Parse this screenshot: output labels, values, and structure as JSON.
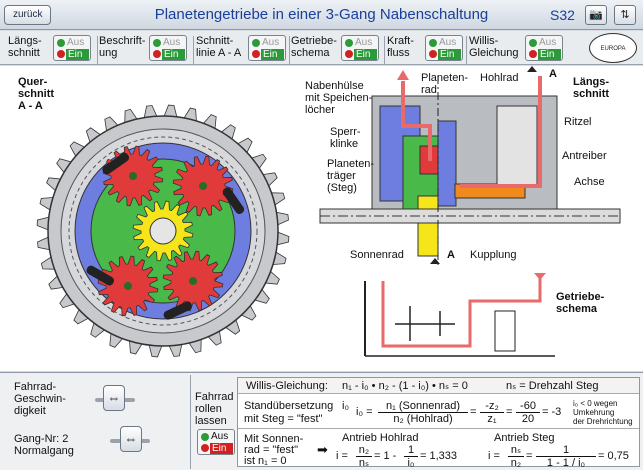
{
  "header": {
    "back_label": "zurück",
    "title": "Planetengetriebe in einer 3-Gang Nabenschaltung",
    "page_number": "S32",
    "icons": [
      "camera-icon",
      "sort-icon"
    ]
  },
  "toggles": [
    {
      "label_line1": "Längs-",
      "label_line2": "schnitt",
      "off": "Aus",
      "on": "Ein",
      "state": "Ein"
    },
    {
      "label_line1": "Beschrift-",
      "label_line2": "ung",
      "off": "Aus",
      "on": "Ein",
      "state": "Ein"
    },
    {
      "label_line1": "Schnitt-",
      "label_line2": "linie A - A",
      "off": "Aus",
      "on": "Ein",
      "state": "Ein"
    },
    {
      "label_line1": "Getriebe-",
      "label_line2": "schema",
      "off": "Aus",
      "on": "Ein",
      "state": "Ein"
    },
    {
      "label_line1": "Kraft-",
      "label_line2": "fluss",
      "off": "Aus",
      "on": "Ein",
      "state": "Ein"
    },
    {
      "label_line1": "Willis-",
      "label_line2": "Gleichung",
      "off": "Aus",
      "on": "Ein",
      "state": "Ein"
    }
  ],
  "logo_text": "EUROPA LEHRMITTEL",
  "diagram": {
    "cross_section_title": "Quer-\nschnitt\nA - A",
    "longitudinal_title": "Längs-\nschnitt",
    "section_mark": "A",
    "labels": {
      "hub_shell": "Nabenhülse\nmit Speichen-\nlöcher",
      "planet_gear": "Planeten-\nrad",
      "ring_gear": "Hohlrad",
      "pawl": "Sperr-\nklinke",
      "planet_carrier": "Planeten-\nträger\n(Steg)",
      "sun_gear": "Sonnenrad",
      "coupling": "Kupplung",
      "sprocket": "Ritzel",
      "driver": "Antreiber",
      "axle": "Achse",
      "schema_title": "Getriebe-\nschema"
    }
  },
  "controls": {
    "speed_label": "Fahrrad-\nGeschwin-\ndigkeit",
    "gear_label": "Gang-Nr: 2\nNormalgang",
    "roll_label": "Fahrrad\nrollen\nlassen",
    "roll_off": "Aus",
    "roll_on": "Ein"
  },
  "formulas": {
    "willis_title": "Willis-Gleichung:",
    "willis_eq": "n₁ - i₀ • n₂ - (1 - i₀) • nₛ = 0",
    "willis_note": "nₛ = Drehzahl Steg",
    "std_label_1": "Standübersetzung",
    "std_label_2": "mit Steg = \"fest\"",
    "std_sym": "i₀",
    "std_eq_i": "i₀ =",
    "std_num_1": "n₁ (Sonnenrad)",
    "std_den_1": "n₂  (Hohlrad)",
    "std_num_2": "-z₂",
    "std_den_2": "z₁",
    "std_num_3": "-60",
    "std_den_3": "20",
    "std_result": "= -3",
    "std_note": "i₀ < 0 wegen\nUmkehrung\nder Drehrichtung",
    "sun_fixed_1": "Mit Sonnen-",
    "sun_fixed_2": "rad = \"fest\"",
    "sun_fixed_3": "ist n₁ = 0",
    "drive_ring_title": "Antrieb Hohlrad",
    "drive_ring_eq": "i = n₂/nₛ = 1 - 1/i₀ = 1,333",
    "drive_ring_result": "= 1,333",
    "drive_carrier_title": "Antrieb Steg",
    "drive_carrier_result": "= 0,75",
    "frac_n2": "n₂",
    "frac_ns": "nₛ",
    "frac_1": "1",
    "frac_i0": "i₀",
    "frac_1m": "1 - 1 / i₀",
    "i_eq": "i =",
    "eq": "=",
    "one_minus": "= 1 -"
  },
  "colors": {
    "title_blue": "#1a3f9a",
    "gear_red": "#e03a3a",
    "gear_green": "#49b94a",
    "sun_yellow": "#f5e51a",
    "carrier_blue": "#6e7de0",
    "flow_red": "#e86a6a",
    "coupling_orange": "#f08a1e",
    "housing_grey": "#b9bcc0",
    "led_green": "#2d9a3a",
    "led_red": "#d12222"
  }
}
